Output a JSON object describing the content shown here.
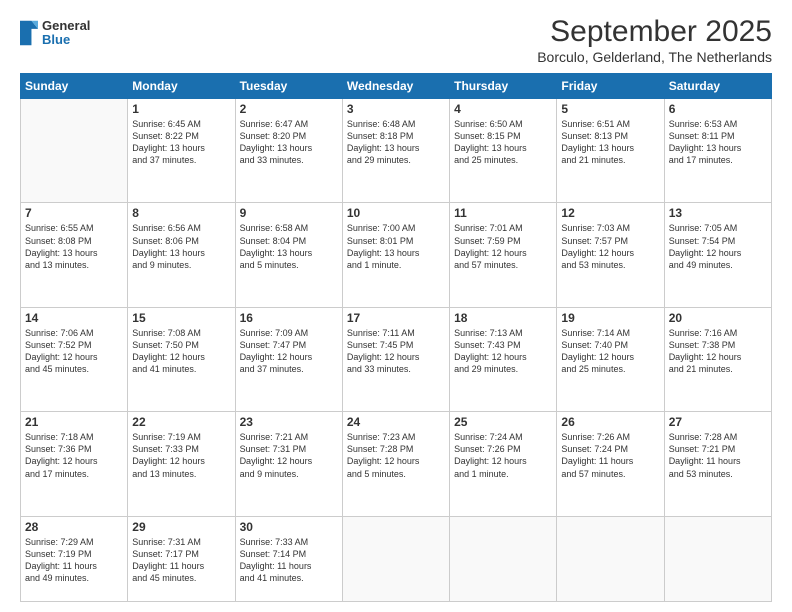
{
  "header": {
    "logo_general": "General",
    "logo_blue": "Blue",
    "title": "September 2025",
    "subtitle": "Borculo, Gelderland, The Netherlands"
  },
  "days_of_week": [
    "Sunday",
    "Monday",
    "Tuesday",
    "Wednesday",
    "Thursday",
    "Friday",
    "Saturday"
  ],
  "weeks": [
    [
      {
        "day": "",
        "text": ""
      },
      {
        "day": "1",
        "text": "Sunrise: 6:45 AM\nSunset: 8:22 PM\nDaylight: 13 hours\nand 37 minutes."
      },
      {
        "day": "2",
        "text": "Sunrise: 6:47 AM\nSunset: 8:20 PM\nDaylight: 13 hours\nand 33 minutes."
      },
      {
        "day": "3",
        "text": "Sunrise: 6:48 AM\nSunset: 8:18 PM\nDaylight: 13 hours\nand 29 minutes."
      },
      {
        "day": "4",
        "text": "Sunrise: 6:50 AM\nSunset: 8:15 PM\nDaylight: 13 hours\nand 25 minutes."
      },
      {
        "day": "5",
        "text": "Sunrise: 6:51 AM\nSunset: 8:13 PM\nDaylight: 13 hours\nand 21 minutes."
      },
      {
        "day": "6",
        "text": "Sunrise: 6:53 AM\nSunset: 8:11 PM\nDaylight: 13 hours\nand 17 minutes."
      }
    ],
    [
      {
        "day": "7",
        "text": "Sunrise: 6:55 AM\nSunset: 8:08 PM\nDaylight: 13 hours\nand 13 minutes."
      },
      {
        "day": "8",
        "text": "Sunrise: 6:56 AM\nSunset: 8:06 PM\nDaylight: 13 hours\nand 9 minutes."
      },
      {
        "day": "9",
        "text": "Sunrise: 6:58 AM\nSunset: 8:04 PM\nDaylight: 13 hours\nand 5 minutes."
      },
      {
        "day": "10",
        "text": "Sunrise: 7:00 AM\nSunset: 8:01 PM\nDaylight: 13 hours\nand 1 minute."
      },
      {
        "day": "11",
        "text": "Sunrise: 7:01 AM\nSunset: 7:59 PM\nDaylight: 12 hours\nand 57 minutes."
      },
      {
        "day": "12",
        "text": "Sunrise: 7:03 AM\nSunset: 7:57 PM\nDaylight: 12 hours\nand 53 minutes."
      },
      {
        "day": "13",
        "text": "Sunrise: 7:05 AM\nSunset: 7:54 PM\nDaylight: 12 hours\nand 49 minutes."
      }
    ],
    [
      {
        "day": "14",
        "text": "Sunrise: 7:06 AM\nSunset: 7:52 PM\nDaylight: 12 hours\nand 45 minutes."
      },
      {
        "day": "15",
        "text": "Sunrise: 7:08 AM\nSunset: 7:50 PM\nDaylight: 12 hours\nand 41 minutes."
      },
      {
        "day": "16",
        "text": "Sunrise: 7:09 AM\nSunset: 7:47 PM\nDaylight: 12 hours\nand 37 minutes."
      },
      {
        "day": "17",
        "text": "Sunrise: 7:11 AM\nSunset: 7:45 PM\nDaylight: 12 hours\nand 33 minutes."
      },
      {
        "day": "18",
        "text": "Sunrise: 7:13 AM\nSunset: 7:43 PM\nDaylight: 12 hours\nand 29 minutes."
      },
      {
        "day": "19",
        "text": "Sunrise: 7:14 AM\nSunset: 7:40 PM\nDaylight: 12 hours\nand 25 minutes."
      },
      {
        "day": "20",
        "text": "Sunrise: 7:16 AM\nSunset: 7:38 PM\nDaylight: 12 hours\nand 21 minutes."
      }
    ],
    [
      {
        "day": "21",
        "text": "Sunrise: 7:18 AM\nSunset: 7:36 PM\nDaylight: 12 hours\nand 17 minutes."
      },
      {
        "day": "22",
        "text": "Sunrise: 7:19 AM\nSunset: 7:33 PM\nDaylight: 12 hours\nand 13 minutes."
      },
      {
        "day": "23",
        "text": "Sunrise: 7:21 AM\nSunset: 7:31 PM\nDaylight: 12 hours\nand 9 minutes."
      },
      {
        "day": "24",
        "text": "Sunrise: 7:23 AM\nSunset: 7:28 PM\nDaylight: 12 hours\nand 5 minutes."
      },
      {
        "day": "25",
        "text": "Sunrise: 7:24 AM\nSunset: 7:26 PM\nDaylight: 12 hours\nand 1 minute."
      },
      {
        "day": "26",
        "text": "Sunrise: 7:26 AM\nSunset: 7:24 PM\nDaylight: 11 hours\nand 57 minutes."
      },
      {
        "day": "27",
        "text": "Sunrise: 7:28 AM\nSunset: 7:21 PM\nDaylight: 11 hours\nand 53 minutes."
      }
    ],
    [
      {
        "day": "28",
        "text": "Sunrise: 7:29 AM\nSunset: 7:19 PM\nDaylight: 11 hours\nand 49 minutes."
      },
      {
        "day": "29",
        "text": "Sunrise: 7:31 AM\nSunset: 7:17 PM\nDaylight: 11 hours\nand 45 minutes."
      },
      {
        "day": "30",
        "text": "Sunrise: 7:33 AM\nSunset: 7:14 PM\nDaylight: 11 hours\nand 41 minutes."
      },
      {
        "day": "",
        "text": ""
      },
      {
        "day": "",
        "text": ""
      },
      {
        "day": "",
        "text": ""
      },
      {
        "day": "",
        "text": ""
      }
    ]
  ]
}
